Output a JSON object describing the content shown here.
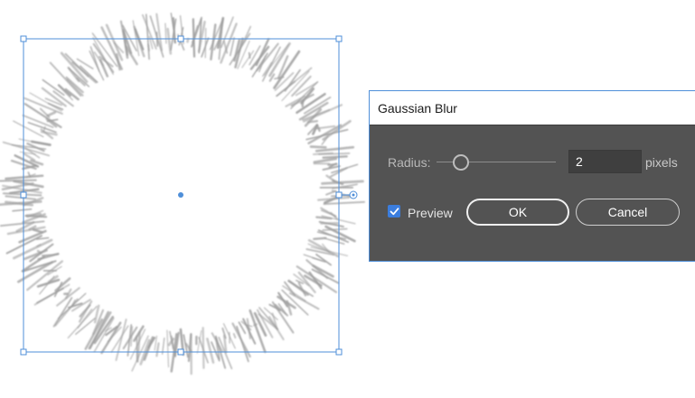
{
  "dialog": {
    "title": "Gaussian Blur",
    "radius_label": "Radius:",
    "radius_value": "2",
    "radius_slider_fraction": 0.14,
    "units": "pixels",
    "preview_label": "Preview",
    "preview_checked": true,
    "ok_label": "OK",
    "cancel_label": "Cancel"
  },
  "colors": {
    "dialog_body": "#535353",
    "selection": "#4f8fd9",
    "checkbox": "#3b7ddd",
    "artwork_stroke": "#9d9d9d"
  },
  "icons": {
    "checkbox": "check-icon",
    "center_point": "center-point-icon",
    "live_shape_widget": "radius-widget-icon"
  }
}
